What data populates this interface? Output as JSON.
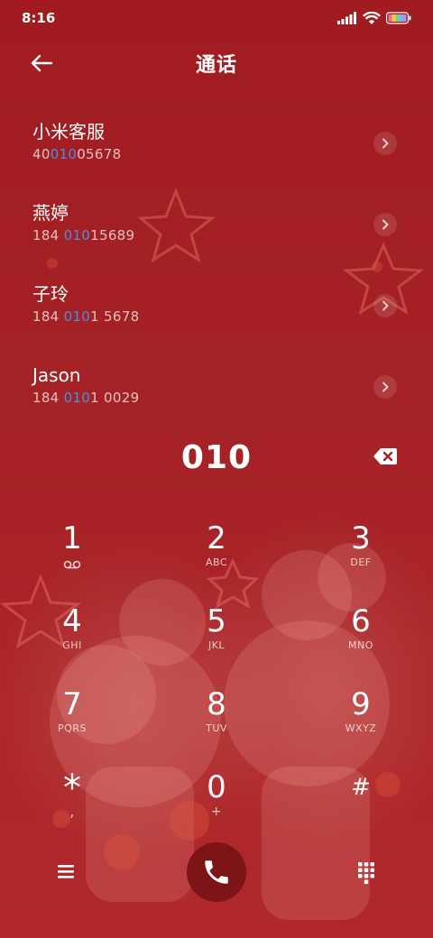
{
  "status_bar": {
    "time": "8:16"
  },
  "header": {
    "title": "通话"
  },
  "contacts": [
    {
      "name": "小米客服",
      "number_pre": "40",
      "number_match": "010",
      "number_post": "05678"
    },
    {
      "name": "燕婷",
      "number_pre": "184 ",
      "number_match": "010",
      "number_post": "15689"
    },
    {
      "name": "子玲",
      "number_pre": "184 ",
      "number_match": "010",
      "number_post": "1 5678"
    },
    {
      "name": "Jason",
      "number_pre": "184 ",
      "number_match": "010",
      "number_post": "1 0029"
    }
  ],
  "dial_display": {
    "number": "010"
  },
  "keypad": [
    {
      "digit": "1",
      "letters": ""
    },
    {
      "digit": "2",
      "letters": "ABC"
    },
    {
      "digit": "3",
      "letters": "DEF"
    },
    {
      "digit": "4",
      "letters": "GHI"
    },
    {
      "digit": "5",
      "letters": "JKL"
    },
    {
      "digit": "6",
      "letters": "MNO"
    },
    {
      "digit": "7",
      "letters": "PQRS"
    },
    {
      "digit": "8",
      "letters": "TUV"
    },
    {
      "digit": "9",
      "letters": "WXYZ"
    },
    {
      "digit": "*",
      "letters": ","
    },
    {
      "digit": "0",
      "letters": "+"
    },
    {
      "digit": "#",
      "letters": ""
    }
  ],
  "colors": {
    "background": "#a11f22",
    "match_highlight": "#4a8fe0",
    "call_button": "#7d1418"
  },
  "icons": {
    "back": "arrow-left-icon",
    "chevron": "chevron-right-icon",
    "delete": "backspace-icon",
    "voicemail": "voicemail-icon",
    "menu": "menu-icon",
    "call": "phone-icon",
    "dialpad": "dialpad-icon"
  }
}
